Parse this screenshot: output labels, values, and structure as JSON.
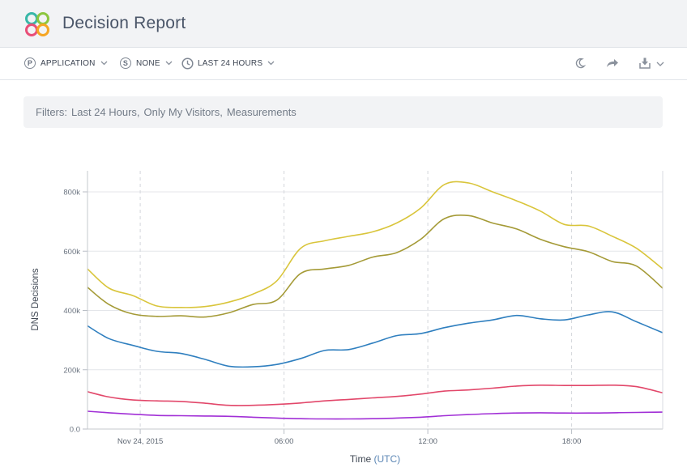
{
  "header": {
    "title": "Decision Report"
  },
  "toolbar": {
    "application": {
      "badge": "P",
      "label": "APPLICATION"
    },
    "source": {
      "badge": "S",
      "label": "NONE"
    },
    "timerange": {
      "label": "LAST 24 HOURS"
    },
    "icons": [
      "moon-icon",
      "share-icon",
      "download-icon",
      "chevron-down-icon"
    ]
  },
  "filters": {
    "prefix": "Filters:",
    "items": [
      "Last 24 Hours,",
      "Only My Visitors,",
      "Measurements"
    ]
  },
  "chart_data": {
    "type": "line",
    "xlabel": "Time",
    "xlabel_unit": "(UTC)",
    "ylabel": "DNS Decisions",
    "ylim": [
      0,
      800000
    ],
    "y_ticks": [
      "0.0",
      "200k",
      "400k",
      "600k",
      "800k"
    ],
    "y_tick_values": [
      0,
      200000,
      400000,
      600000,
      800000
    ],
    "x_range_hours": [
      -2.2,
      21.8
    ],
    "x_ticks": [
      {
        "hour": 0,
        "label": "Nov 24, 2015"
      },
      {
        "hour": 6,
        "label": "06:00"
      },
      {
        "hour": 12,
        "label": "12:00"
      },
      {
        "hour": 18,
        "label": "18:00"
      }
    ],
    "grid": true,
    "series": [
      {
        "color": "#d9c53b",
        "x": [
          -2.2,
          -1.3,
          -0.3,
          0.7,
          1.7,
          2.7,
          3.7,
          4.7,
          5.7,
          6.7,
          7.7,
          8.7,
          9.7,
          10.7,
          11.7,
          12.7,
          13.7,
          14.7,
          15.7,
          16.7,
          17.7,
          18.7,
          19.7,
          20.7,
          21.8
        ],
        "values": [
          540000,
          475000,
          450000,
          415000,
          410000,
          413000,
          428000,
          455000,
          500000,
          610000,
          635000,
          650000,
          665000,
          695000,
          745000,
          825000,
          830000,
          800000,
          770000,
          735000,
          690000,
          685000,
          650000,
          610000,
          540000
        ]
      },
      {
        "color": "#a49a36",
        "x": [
          -2.2,
          -1.3,
          -0.3,
          0.7,
          1.7,
          2.7,
          3.7,
          4.7,
          5.7,
          6.7,
          7.7,
          8.7,
          9.7,
          10.7,
          11.7,
          12.7,
          13.7,
          14.7,
          15.7,
          16.7,
          17.7,
          18.7,
          19.7,
          20.7,
          21.8
        ],
        "values": [
          478000,
          420000,
          388000,
          380000,
          382000,
          378000,
          392000,
          420000,
          435000,
          525000,
          540000,
          552000,
          580000,
          595000,
          640000,
          710000,
          720000,
          695000,
          675000,
          640000,
          615000,
          598000,
          565000,
          550000,
          475000
        ]
      },
      {
        "color": "#2f7fbf",
        "x": [
          -2.2,
          -1.3,
          -0.3,
          0.7,
          1.7,
          2.7,
          3.7,
          4.7,
          5.7,
          6.7,
          7.7,
          8.7,
          9.7,
          10.7,
          11.7,
          12.7,
          13.7,
          14.7,
          15.7,
          16.7,
          17.7,
          18.7,
          19.7,
          20.7,
          21.8
        ],
        "values": [
          348000,
          305000,
          282000,
          262000,
          255000,
          235000,
          212000,
          210000,
          218000,
          238000,
          265000,
          268000,
          290000,
          315000,
          322000,
          342000,
          357000,
          368000,
          383000,
          372000,
          368000,
          385000,
          395000,
          362000,
          325000
        ]
      },
      {
        "color": "#e2476a",
        "x": [
          -2.2,
          -1.3,
          -0.3,
          0.7,
          1.7,
          2.7,
          3.7,
          4.7,
          5.7,
          6.7,
          7.7,
          8.7,
          9.7,
          10.7,
          11.7,
          12.7,
          13.7,
          14.7,
          15.7,
          16.7,
          17.7,
          18.7,
          19.7,
          20.7,
          21.8
        ],
        "values": [
          126000,
          108000,
          98000,
          95000,
          93000,
          87000,
          80000,
          80000,
          83000,
          88000,
          95000,
          100000,
          105000,
          110000,
          118000,
          128000,
          132000,
          138000,
          145000,
          148000,
          147000,
          147000,
          148000,
          143000,
          122000
        ]
      },
      {
        "color": "#a12fd6",
        "x": [
          -2.2,
          -1.3,
          -0.3,
          0.7,
          1.7,
          2.7,
          3.7,
          4.7,
          5.7,
          6.7,
          7.7,
          8.7,
          9.7,
          10.7,
          11.7,
          12.7,
          13.7,
          14.7,
          15.7,
          16.7,
          17.7,
          18.7,
          19.7,
          20.7,
          21.8
        ],
        "values": [
          60000,
          55000,
          50000,
          46000,
          45000,
          44000,
          43000,
          40000,
          37000,
          35000,
          34000,
          34000,
          35000,
          37000,
          40000,
          45000,
          49000,
          52000,
          54000,
          55000,
          54000,
          54000,
          55000,
          56000,
          57000
        ]
      }
    ]
  },
  "colors": {
    "header_bg": "#f2f3f5",
    "filter_bg": "#f2f3f5",
    "grid": "#e3e5e9",
    "axis_text": "#6b7480"
  }
}
